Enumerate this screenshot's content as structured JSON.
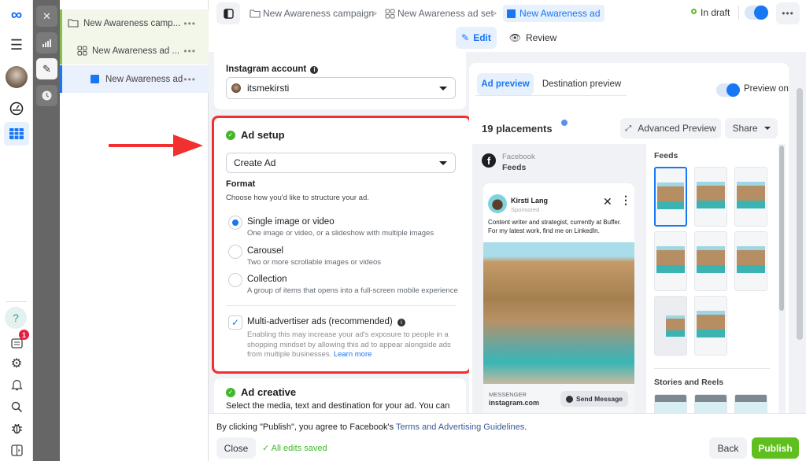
{
  "nav": {
    "items": [
      {
        "icon": "meta-logo-icon"
      },
      {
        "icon": "menu-icon"
      },
      {
        "icon": "avatar"
      },
      {
        "icon": "dashboard-gauge-icon"
      },
      {
        "icon": "ads-manager-table-icon"
      }
    ],
    "bottom": [
      {
        "icon": "help-icon",
        "glyph": "?"
      },
      {
        "icon": "news-icon",
        "badge": "1"
      },
      {
        "icon": "settings-icon"
      },
      {
        "icon": "notifications-bell-icon"
      },
      {
        "icon": "search-icon"
      },
      {
        "icon": "bug-report-icon"
      },
      {
        "icon": "panel-toggle-icon"
      }
    ]
  },
  "rail": {
    "close": "close-icon",
    "charts": "bar-chart-icon",
    "edit": "pencil-icon",
    "history": "clock-icon"
  },
  "tree": {
    "campaign": "New Awareness camp...",
    "adset": "New Awareness ad ...",
    "ad": "New Awareness ad",
    "more": "•••"
  },
  "header": {
    "breadcrumb": [
      "New Awareness campaign",
      "New Awareness ad set",
      "New Awareness ad"
    ],
    "separator": ">",
    "status": "In draft",
    "edit_tab": "Edit",
    "review_tab": "Review",
    "more": "•••"
  },
  "form": {
    "instagram_label": "Instagram account",
    "instagram_value": "itsmekirsti",
    "ad_setup_title": "Ad setup",
    "ad_setup_select": "Create Ad",
    "format_label": "Format",
    "format_help": "Choose how you'd like to structure your ad.",
    "formats": [
      {
        "title": "Single image or video",
        "desc": "One image or video, or a slideshow with multiple images",
        "selected": true
      },
      {
        "title": "Carousel",
        "desc": "Two or more scrollable images or videos",
        "selected": false
      },
      {
        "title": "Collection",
        "desc": "A group of items that opens into a full-screen mobile experience",
        "selected": false
      }
    ],
    "multi_label": "Multi-advertiser ads (recommended)",
    "multi_checked": true,
    "multi_desc_1": "Enabling this may increase your ad's exposure to people in a",
    "multi_desc_2": "shopping mindset by allowing this ad to appear alongside ads",
    "multi_desc_3": "from multiple businesses.",
    "learn_more": "Learn more",
    "creative_title": "Ad creative",
    "creative_desc": "Select the media, text and destination for your ad. You can"
  },
  "preview": {
    "tab_ad": "Ad preview",
    "tab_dest": "Destination preview",
    "toggle_label": "Preview on",
    "placements": "19 placements",
    "advanced": "Advanced Preview",
    "share": "Share",
    "platform": "Facebook",
    "placement": "Feeds",
    "post_name": "Kirsti Lang",
    "post_sponsored": "Sponsored · ",
    "post_text_1": "Content writer and strategist, currently at Buffer.",
    "post_text_2": "For my latest work, find me on LinkedIn.",
    "cta_source": "MESSENGER",
    "cta_domain": "instagram.com",
    "cta_button": "Send Message",
    "feeds_title": "Feeds",
    "stories_title": "Stories and Reels"
  },
  "footer": {
    "agree_prefix": "By clicking \"Publish\", you agree to Facebook's ",
    "agree_link": "Terms and Advertising Guidelines",
    "agree_suffix": ".",
    "close": "Close",
    "saved": "All edits saved",
    "back": "Back",
    "publish": "Publish"
  },
  "colors": {
    "accent": "#1877f2",
    "publish": "#5fbf1f",
    "annotation": "#f23030",
    "success": "#42b72a"
  }
}
